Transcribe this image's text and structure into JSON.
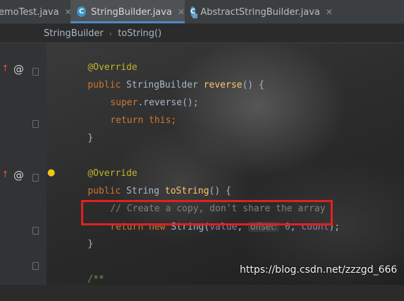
{
  "tabs": [
    {
      "label": "emoTest.java",
      "active": false
    },
    {
      "label": "StringBuilder.java",
      "active": true
    },
    {
      "label": "AbstractStringBuilder.java",
      "active": false
    }
  ],
  "breadcrumb": [
    "StringBuilder",
    "toString()"
  ],
  "code": {
    "l1_annotation": "@Override",
    "l2_public": "public",
    "l2_type": " StringBuilder ",
    "l2_method": "reverse",
    "l2_rest": "() {",
    "l3_super": "super",
    "l3_rest": ".reverse();",
    "l4_return": "return",
    "l4_this": " this;",
    "l5_close": "}",
    "l7_annotation": "@Override",
    "l8_public": "public",
    "l8_type": " String ",
    "l8_method": "toString",
    "l8_rest": "() {",
    "l9_comment": "// Create a copy, don't share the array",
    "l10_return": "return new",
    "l10_class": " String(",
    "l10_value": "value",
    "l10_comma1": ", ",
    "l10_hint": "offset:",
    "l10_zero": " 0",
    "l10_comma2": ", ",
    "l10_count": "count",
    "l10_end": ");",
    "l11_close": "}",
    "l13_doc": "/**"
  },
  "watermark": "https://blog.csdn.net/zzzgd_666",
  "colors": {
    "keyword": "#cc7832",
    "annotation": "#bbb529",
    "method": "#ffc66d",
    "field": "#9876aa",
    "number": "#6897bb",
    "highlight_box": "#e02020",
    "tab_accent": "#4a88c7"
  },
  "icons": {
    "tab_class": "class-c-icon",
    "tab_abstract": "abstract-class-icon",
    "gutter_override": "override-arrow-icon",
    "gutter_annotation": "at-annotation-icon",
    "gutter_bulb": "lightbulb-icon"
  }
}
